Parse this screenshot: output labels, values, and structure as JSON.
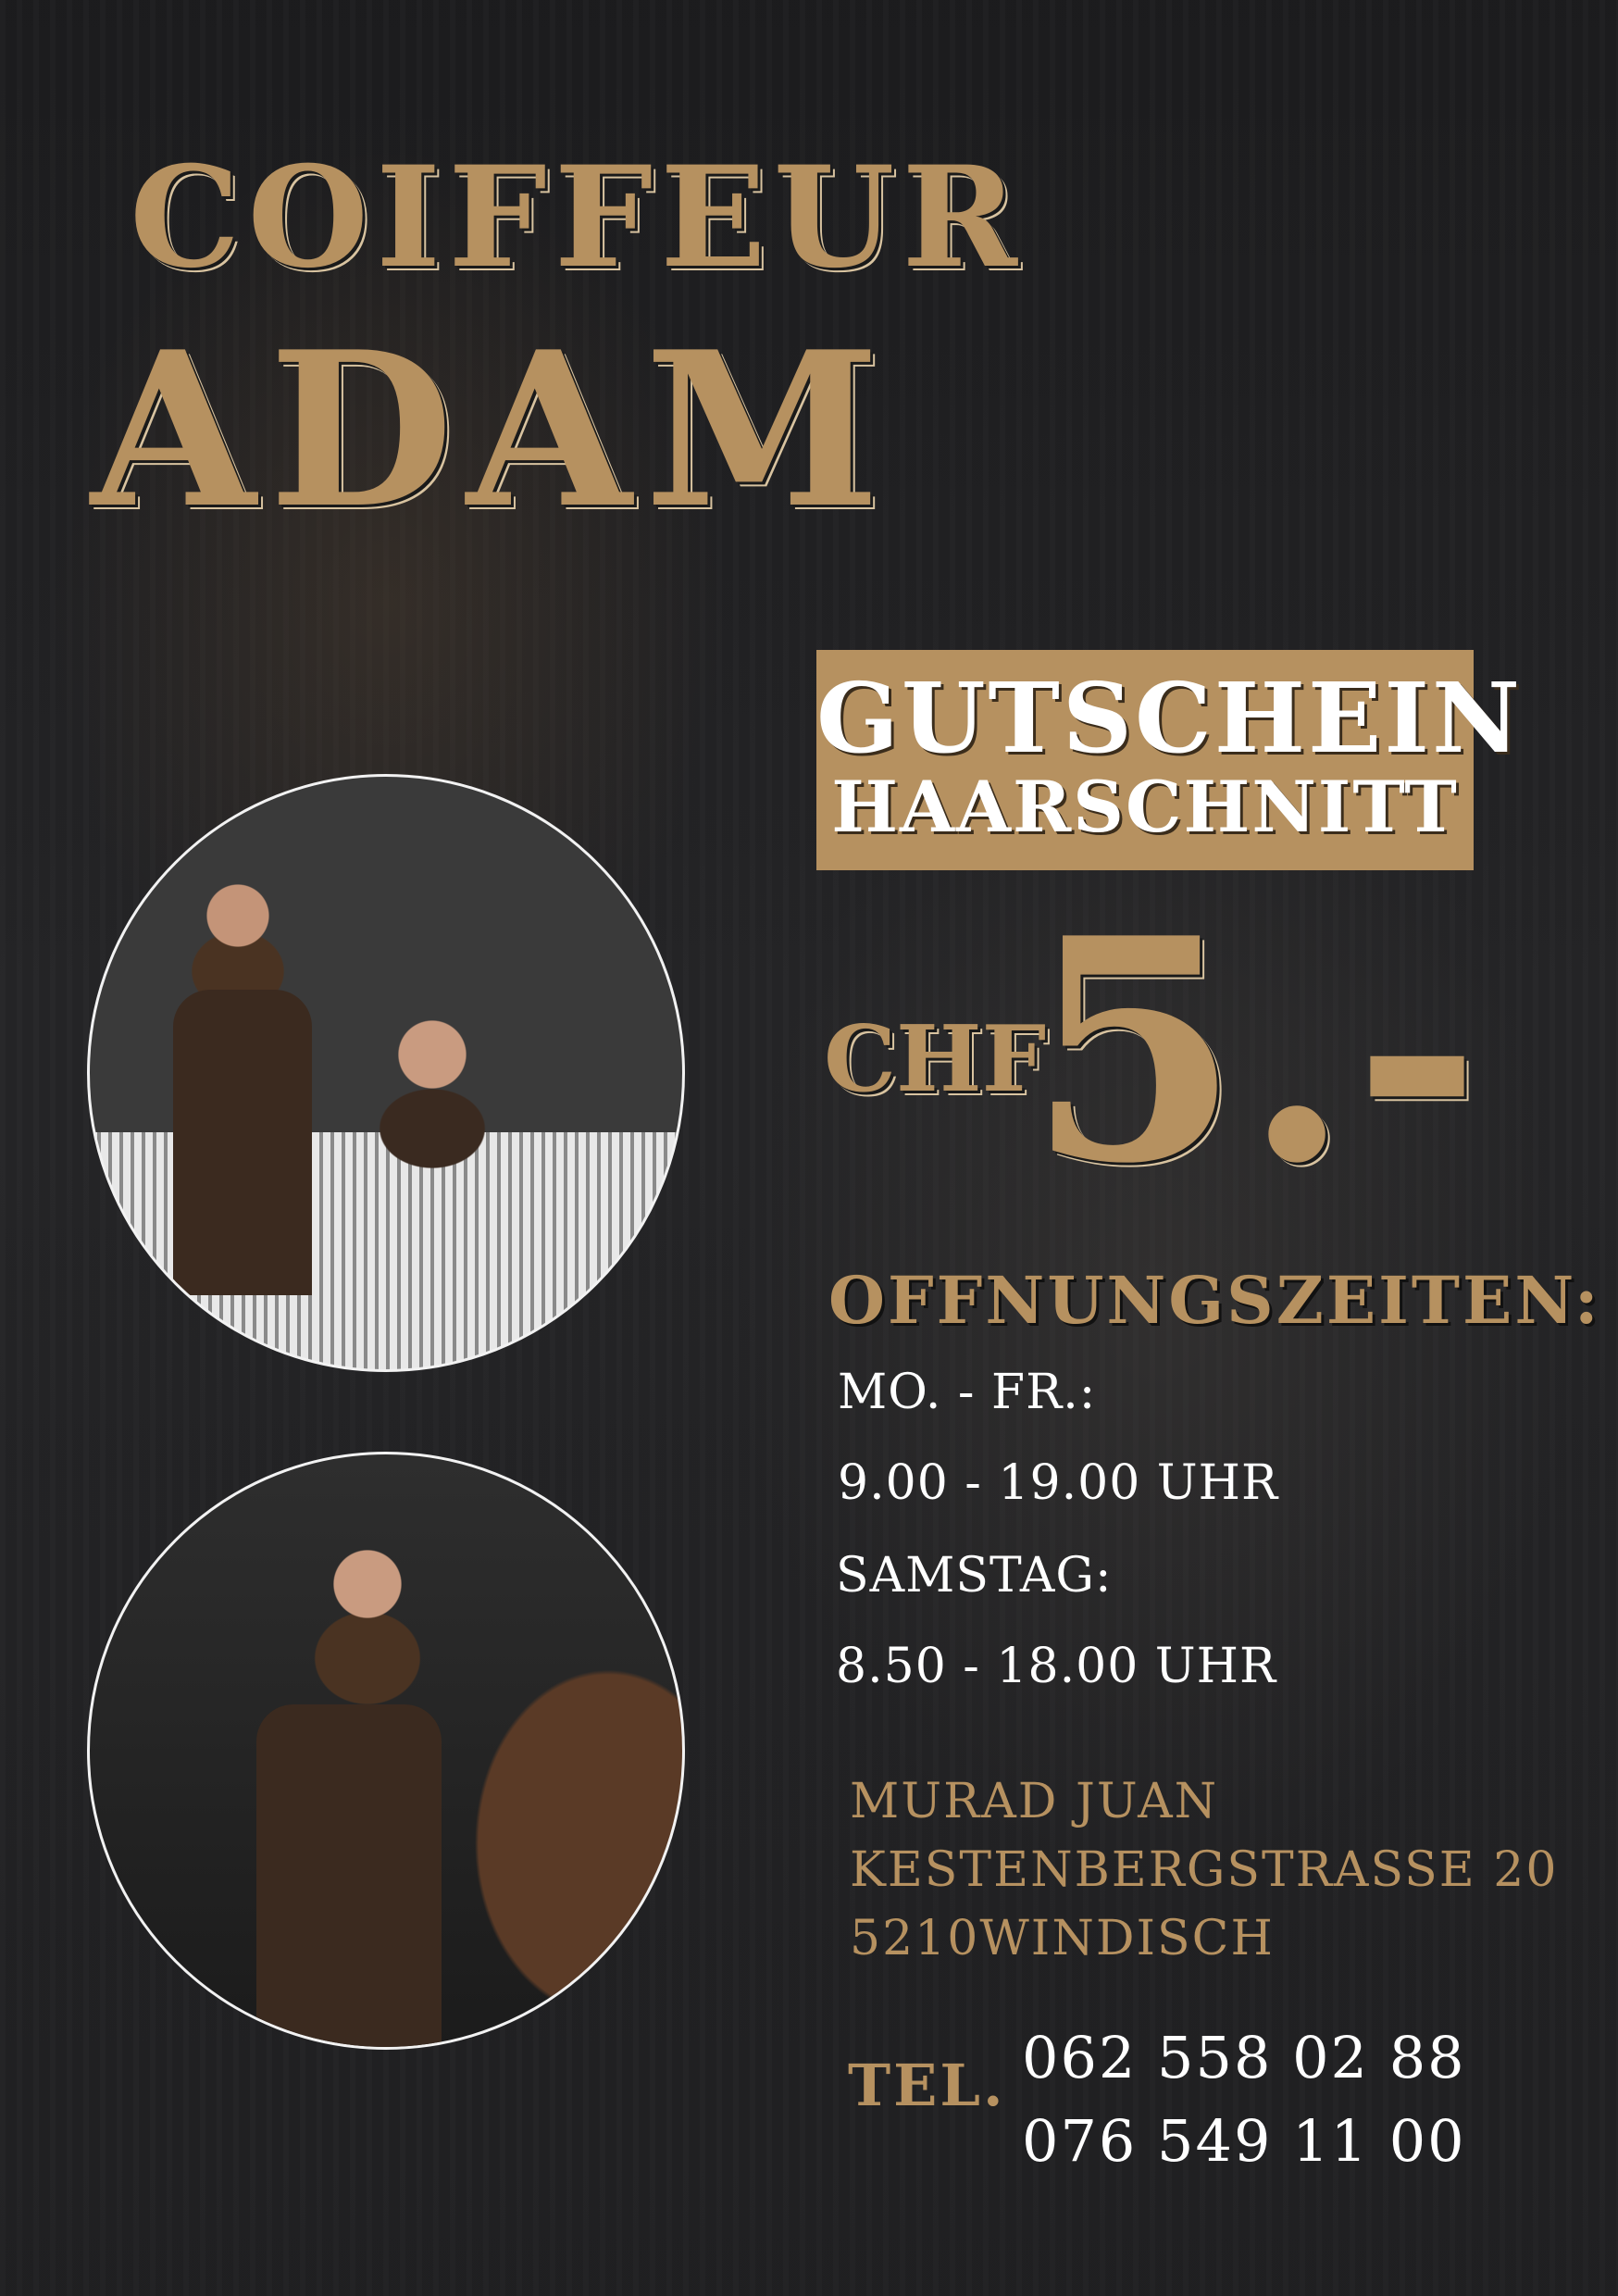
{
  "brand": {
    "line1": "COIFFEUR",
    "line2": "ADAM"
  },
  "voucher": {
    "line1": "GUTSCHEIN",
    "line2": "HAARSCHNITT",
    "currency": "CHF",
    "price": "5.-"
  },
  "hours": {
    "title": "OFFNUNGSZEITEN:",
    "weekday_label": "MO. - FR.:",
    "weekday_time": "9.00  - 19.00 UHR",
    "saturday_label": "SAMSTAG:",
    "saturday_time": "8.50  - 18.00 UHR"
  },
  "address": {
    "name": "MURAD JUAN",
    "street": "KESTENBERGSTRASSE 20",
    "city": "5210WINDISCH"
  },
  "contact": {
    "tel_label": "TEL.",
    "phone1": "062 558 02 88",
    "phone2": "076 549 11 00"
  },
  "colors": {
    "gold": "#b69160",
    "background": "#1f1f21",
    "text": "#ffffff"
  }
}
